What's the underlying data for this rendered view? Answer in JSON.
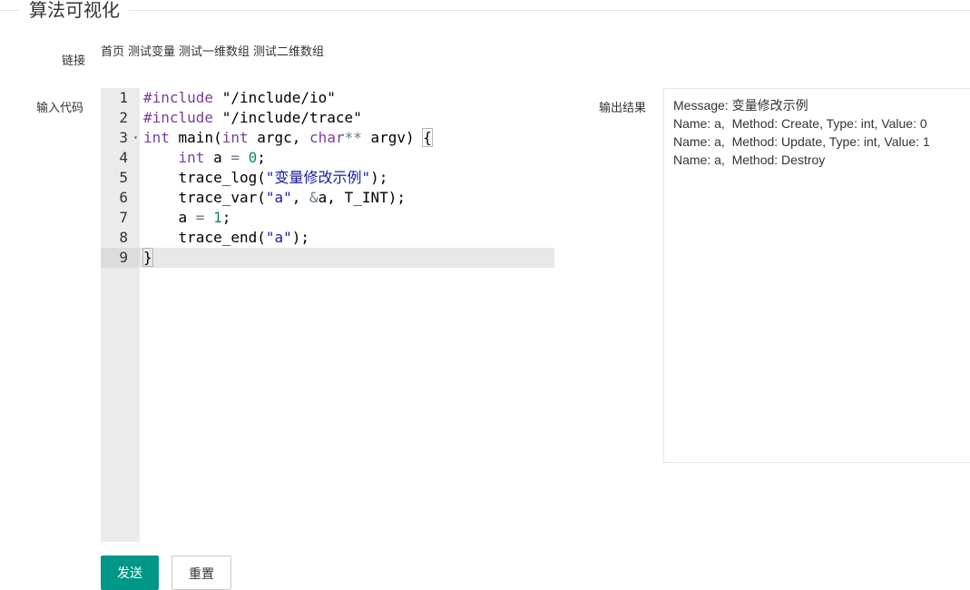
{
  "page": {
    "title": "算法可视化"
  },
  "links": {
    "label": "链接",
    "items": [
      "首页",
      "测试变量",
      "测试一维数组",
      "测试二维数组"
    ]
  },
  "editor": {
    "label": "输入代码",
    "active_line": 9,
    "lines": [
      {
        "num": "1",
        "tokens": [
          {
            "t": "#include",
            "c": "pp"
          },
          {
            "t": " \"/include/io\"",
            "c": ""
          }
        ]
      },
      {
        "num": "2",
        "tokens": [
          {
            "t": "#include",
            "c": "pp"
          },
          {
            "t": " \"/include/trace\"",
            "c": ""
          }
        ]
      },
      {
        "num": "3",
        "fold": true,
        "tokens": [
          {
            "t": "int",
            "c": "kw"
          },
          {
            "t": " main(",
            "c": ""
          },
          {
            "t": "int",
            "c": "kw"
          },
          {
            "t": " argc, ",
            "c": ""
          },
          {
            "t": "char",
            "c": "kw"
          },
          {
            "t": "**",
            "c": "op"
          },
          {
            "t": " argv) ",
            "c": ""
          },
          {
            "t": "{",
            "c": "brace"
          }
        ]
      },
      {
        "num": "4",
        "tokens": [
          {
            "t": "    ",
            "c": ""
          },
          {
            "t": "int",
            "c": "kw"
          },
          {
            "t": " a ",
            "c": ""
          },
          {
            "t": "=",
            "c": "op"
          },
          {
            "t": " ",
            "c": ""
          },
          {
            "t": "0",
            "c": "num-lit"
          },
          {
            "t": ";",
            "c": ""
          }
        ]
      },
      {
        "num": "5",
        "tokens": [
          {
            "t": "    trace_log(",
            "c": ""
          },
          {
            "t": "\"变量修改示例\"",
            "c": "str"
          },
          {
            "t": ");",
            "c": ""
          }
        ]
      },
      {
        "num": "6",
        "tokens": [
          {
            "t": "    trace_var(",
            "c": ""
          },
          {
            "t": "\"a\"",
            "c": "str"
          },
          {
            "t": ", ",
            "c": ""
          },
          {
            "t": "&",
            "c": "op"
          },
          {
            "t": "a, T_INT);",
            "c": ""
          }
        ]
      },
      {
        "num": "7",
        "tokens": [
          {
            "t": "    a ",
            "c": ""
          },
          {
            "t": "=",
            "c": "op"
          },
          {
            "t": " ",
            "c": ""
          },
          {
            "t": "1",
            "c": "num-lit"
          },
          {
            "t": ";",
            "c": ""
          }
        ]
      },
      {
        "num": "8",
        "tokens": [
          {
            "t": "    trace_end(",
            "c": ""
          },
          {
            "t": "\"a\"",
            "c": "str"
          },
          {
            "t": ");",
            "c": ""
          }
        ]
      },
      {
        "num": "9",
        "tokens": [
          {
            "t": "}",
            "c": "brace"
          }
        ]
      }
    ]
  },
  "output": {
    "label": "输出结果",
    "lines": [
      "Message: 变量修改示例",
      "Name: a,  Method: Create, Type: int, Value: 0",
      "Name: a,  Method: Update, Type: int, Value: 1",
      "Name: a,  Method: Destroy"
    ]
  },
  "buttons": {
    "send": "发送",
    "reset": "重置"
  },
  "colors": {
    "primary": "#009688",
    "keyword": "#7a3e9d",
    "string": "#1a1aa6",
    "number": "#09885a"
  }
}
